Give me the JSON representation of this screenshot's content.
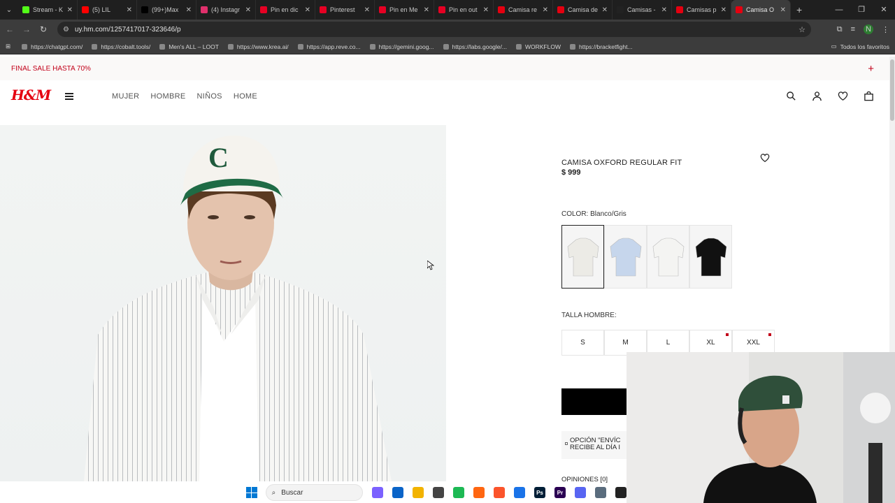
{
  "browser": {
    "tabs": [
      {
        "label": "Stream - K",
        "color": "#53fc18"
      },
      {
        "label": "(5) LIL",
        "color": "#ff0000"
      },
      {
        "label": "(99+)Max",
        "color": "#000000"
      },
      {
        "label": "(4) Instagr",
        "color": "#e1306c"
      },
      {
        "label": "Pin en dic",
        "color": "#e60023"
      },
      {
        "label": "Pinterest",
        "color": "#e60023"
      },
      {
        "label": "Pin en Me",
        "color": "#e60023"
      },
      {
        "label": "Pin en out",
        "color": "#e60023"
      },
      {
        "label": "Camisa re",
        "color": "#e50010"
      },
      {
        "label": "Camisa de",
        "color": "#e50010"
      },
      {
        "label": "Camisas -",
        "color": "#222222"
      },
      {
        "label": "Camisas p",
        "color": "#e50010"
      },
      {
        "label": "Camisa O",
        "color": "#e50010",
        "active": true
      }
    ],
    "url": "uy.hm.com/1257417017-323646/p",
    "profile_initial": "N",
    "bookmarks": [
      "https://chatgpt.com/",
      "https://cobalt.tools/",
      "Men's ALL – LOOT",
      "https://www.krea.ai/",
      "https://app.reve.co...",
      "https://gemini.goog...",
      "https://labs.google/...",
      "WORKFLOW",
      "https://bracketfight..."
    ],
    "all_bookmarks": "Todos los favoritos"
  },
  "promo": {
    "text": "FINAL SALE HASTA 70%",
    "plus": "+"
  },
  "header": {
    "logo": "H&M",
    "nav": [
      "MUJER",
      "HOMBRE",
      "NIÑOS",
      "HOME"
    ],
    "icons": [
      "search-icon",
      "account-icon",
      "heart-icon",
      "bag-icon"
    ]
  },
  "product": {
    "title": "CAMISA OXFORD REGULAR FIT",
    "price": "$ 999",
    "color_label": "COLOR: Blanco/Gris",
    "swatches": [
      {
        "name": "blanco-gris",
        "color": "#ecebe6",
        "selected": true
      },
      {
        "name": "celeste",
        "color": "#c6d6ec"
      },
      {
        "name": "blanco",
        "color": "#f4f4f2"
      },
      {
        "name": "negro",
        "color": "#111111"
      }
    ],
    "size_label": "TALLA HOMBRE:",
    "sizes": [
      {
        "label": "S",
        "low_stock": false
      },
      {
        "label": "M",
        "low_stock": false
      },
      {
        "label": "L",
        "low_stock": false
      },
      {
        "label": "XL",
        "low_stock": true
      },
      {
        "label": "XXL",
        "low_stock": true
      }
    ],
    "delivery_line1": "OPCIÓN \"ENVÍC",
    "delivery_line2": "RECIBE AL DÍA I",
    "reviews": "OPINIONES [0]"
  },
  "taskbar": {
    "search_placeholder": "Buscar",
    "apps": [
      {
        "name": "copilot",
        "color": "#7b61ff"
      },
      {
        "name": "outlook",
        "color": "#0a64c8"
      },
      {
        "name": "explorer",
        "color": "#f2b300"
      },
      {
        "name": "obs",
        "color": "#444444"
      },
      {
        "name": "spotify",
        "color": "#1db954"
      },
      {
        "name": "firefox",
        "color": "#ff6611"
      },
      {
        "name": "brave",
        "color": "#fb542b"
      },
      {
        "name": "chrome",
        "color": "#1a73e8"
      },
      {
        "name": "photoshop",
        "color": "#001e36",
        "label": "Ps"
      },
      {
        "name": "premiere",
        "color": "#2a0052",
        "label": "Pr"
      },
      {
        "name": "discord",
        "color": "#5865f2"
      },
      {
        "name": "settings",
        "color": "#5a6c7d"
      },
      {
        "name": "capcut",
        "color": "#222222"
      }
    ]
  }
}
